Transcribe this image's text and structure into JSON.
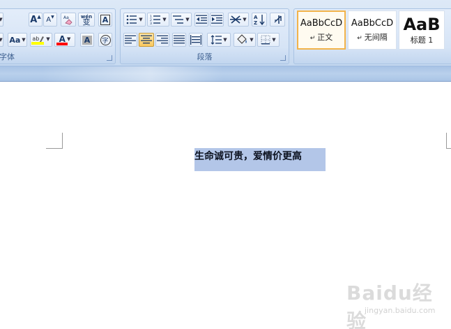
{
  "ribbon": {
    "font_group": {
      "label": "字体",
      "grow_font_label": "A",
      "shrink_font_label": "A",
      "phonetic_label": "wén",
      "phonetic_char": "变",
      "char_border_label": "A",
      "change_case_label": "Aa",
      "highlight_label": "ab",
      "font_color_label": "A",
      "char_shading_label": "A",
      "enclose_char_label": "字"
    },
    "paragraph_group": {
      "label": "段落"
    },
    "styles_group": {
      "styles": [
        {
          "sample": "AaBbCcD",
          "name": "正文",
          "selected": true
        },
        {
          "sample": "AaBbCcD",
          "name": "无间隔",
          "selected": false
        },
        {
          "sample": "AaB",
          "name": "标题 1",
          "selected": false
        }
      ]
    }
  },
  "document": {
    "selected_text": "生命诚可贵，爱情价更高"
  },
  "watermark": {
    "logo": "Baidu经验",
    "sub": "jingyan.baidu.com"
  },
  "colors": {
    "highlight": "#ffff00",
    "font_color": "#ff0000",
    "selection": "#b3c6e8",
    "style_selected_border": "#f2b34a"
  }
}
